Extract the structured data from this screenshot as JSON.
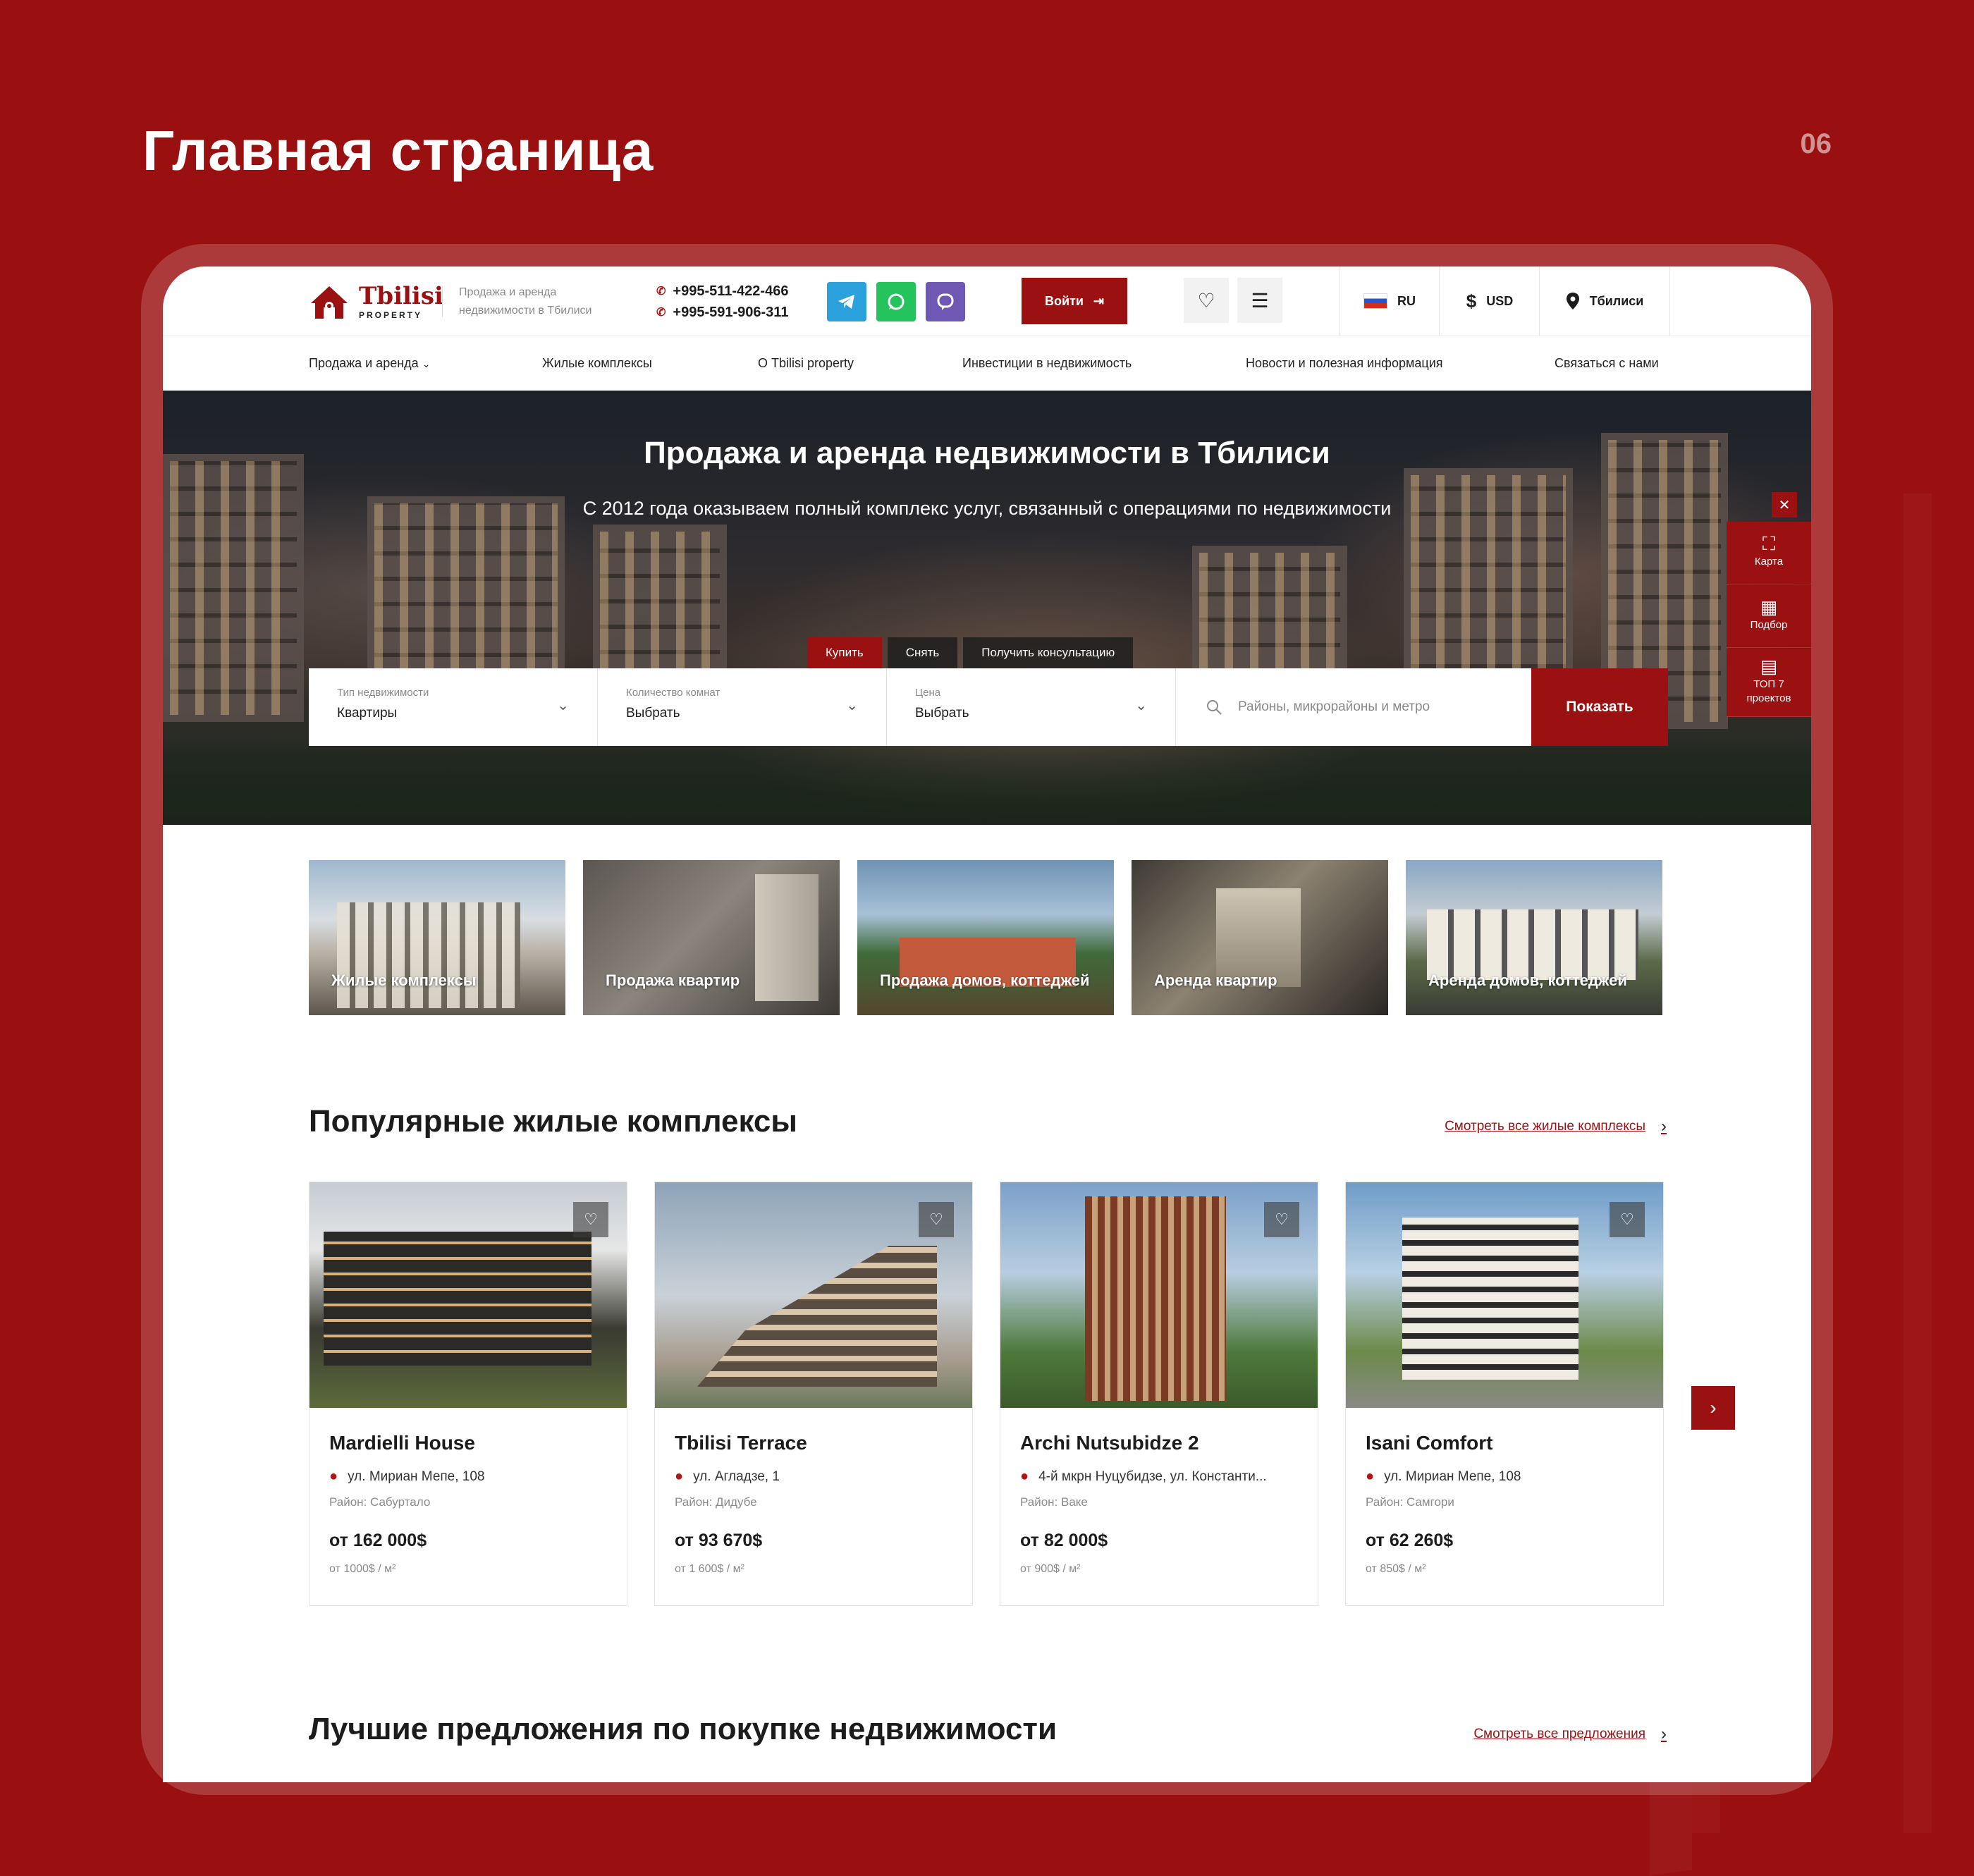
{
  "slide": {
    "title": "Главная страница",
    "number": "06"
  },
  "header": {
    "logo": {
      "brand": "Tbilisi",
      "sub": "PROPERTY"
    },
    "tagline": "Продажа и аренда недвижимости в Тбилиси",
    "phones": [
      "+995-511-422-466",
      "+995-591-906-311"
    ],
    "messengers": [
      "telegram-icon",
      "whatsapp-icon",
      "viber-icon"
    ],
    "login_label": "Войти",
    "language": "RU",
    "currency": "USD",
    "city": "Тбилиси"
  },
  "nav": {
    "items": [
      "Продажа и аренда",
      "Жилые комплексы",
      "О Tbilisi property",
      "Инвестиции в недвижимость",
      "Новости и полезная информация",
      "Связаться с нами"
    ]
  },
  "hero": {
    "title": "Продажа и аренда недвижимости в Тбилиси",
    "subtitle": "С 2012 года оказываем полный комплекс услуг, связанный с операциями по недвижимости",
    "tabs": [
      "Купить",
      "Снять",
      "Получить консультацию"
    ],
    "active_tab": "Купить",
    "search": {
      "type_label": "Тип недвижимости",
      "type_value": "Квартиры",
      "rooms_label": "Количество комнат",
      "rooms_value": "Выбрать",
      "price_label": "Цена",
      "price_value": "Выбрать",
      "location_placeholder": "Районы, микрорайоны и метро",
      "submit": "Показать"
    },
    "side": [
      "Карта",
      "Подбор",
      "ТОП 7 проектов"
    ]
  },
  "categories": [
    "Жилые комплексы",
    "Продажа квартир",
    "Продажа домов, коттеджей",
    "Аренда квартир",
    "Аренда домов, коттеджей"
  ],
  "popular": {
    "title": "Популярные жилые комплексы",
    "link": "Смотреть все жилые комплексы",
    "cards": [
      {
        "name": "Mardielli House",
        "address": "ул. Мириан Мепе, 108",
        "district": "Район: Сабуртало",
        "price": "от 162 000$",
        "per_m2": "от 1000$ / м²"
      },
      {
        "name": "Tbilisi Terrace",
        "address": "ул. Агладзе, 1",
        "district": "Район: Дидубе",
        "price": "от 93 670$",
        "per_m2": "от 1 600$ / м²"
      },
      {
        "name": "Archi Nutsubidze 2",
        "address": "4-й мкрн Нуцубидзе, ул. Константи...",
        "district": "Район: Ваке",
        "price": "от 82 000$",
        "per_m2": "от 900$ / м²"
      },
      {
        "name": "Isani Comfort",
        "address": "ул. Мириан Мепе, 108",
        "district": "Район: Самгори",
        "price": "от 62 260$",
        "per_m2": "от 850$ / м²"
      }
    ]
  },
  "offers": {
    "title": "Лучшие предложения по покупке недвижимости",
    "link": "Смотреть все предложения"
  },
  "colors": {
    "brand": "#9b1111",
    "background": "#9a0f0f"
  }
}
